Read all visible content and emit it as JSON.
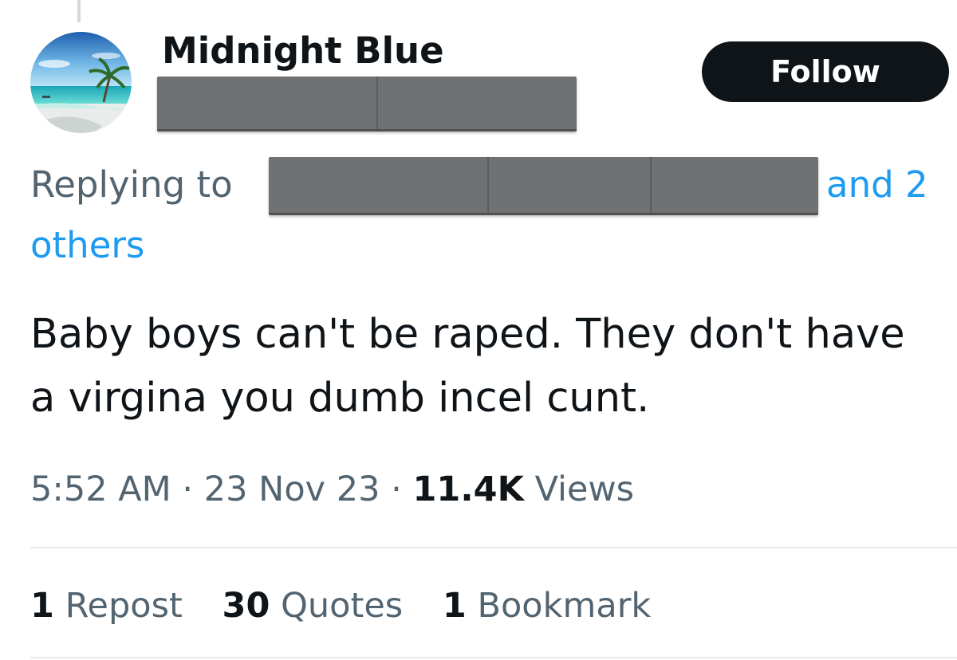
{
  "tweet": {
    "author": {
      "display_name": "Midnight Blue",
      "avatar_icon": "avatar-tropical-beach-palm"
    },
    "follow_label": "Follow",
    "reply_context": {
      "prefix": "Replying to",
      "suffix_line1": "and 2",
      "suffix_line2": "others"
    },
    "text": "Baby boys can't be raped. They don't have a virgina you dumb incel cunt.",
    "meta": {
      "time": "5:52 AM",
      "sep1": "·",
      "date": "23 Nov 23",
      "sep2": "·",
      "views_count": "11.4K",
      "views_label": "Views"
    },
    "stats": {
      "reposts_count": "1",
      "reposts_label": "Repost",
      "quotes_count": "30",
      "quotes_label": "Quotes",
      "bookmarks_count": "1",
      "bookmarks_label": "Bookmark"
    }
  },
  "colors": {
    "text_primary": "#0f1419",
    "text_secondary": "#536471",
    "link": "#1d9bf0",
    "button_bg": "#0f1419",
    "redaction": "#6f7173"
  }
}
